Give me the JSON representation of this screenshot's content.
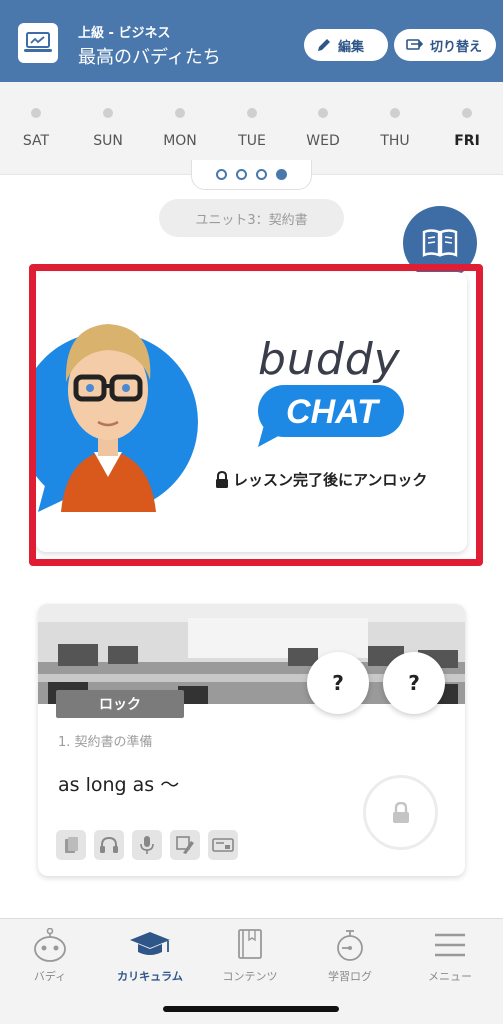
{
  "header": {
    "course_level": "上級 - ビジネス",
    "course_name": "最高のバディたち",
    "edit_label": "編集",
    "switch_label": "切り替え",
    "bg_color": "#4a78ad"
  },
  "week": {
    "days": [
      "SAT",
      "SUN",
      "MON",
      "TUE",
      "WED",
      "THU",
      "FRI"
    ],
    "active_day": "FRI",
    "pages": 4,
    "active_page": 4
  },
  "unit": {
    "label": "ユニット3：契約書"
  },
  "buddy_chat": {
    "word_buddy": "buddy",
    "word_chat": "CHAT",
    "unlock_text": "レッスン完了後にアンロック",
    "accent": "#1e88e5"
  },
  "lesson": {
    "status": "ロック",
    "number_title": "1. 契約書の準備",
    "phrase": "as long as 〜",
    "skills": [
      "card-icon",
      "headphones-icon",
      "microphone-icon",
      "pronunciation-icon",
      "flashcard-icon"
    ],
    "quiz_buttons": [
      "?",
      "?"
    ]
  },
  "nav": {
    "items": [
      {
        "label": "バディ",
        "icon": "robot-icon"
      },
      {
        "label": "カリキュラム",
        "icon": "graduation-cap-icon"
      },
      {
        "label": "コンテンツ",
        "icon": "book-icon"
      },
      {
        "label": "学習ログ",
        "icon": "stopwatch-icon"
      },
      {
        "label": "メニュー",
        "icon": "menu-icon"
      }
    ],
    "active": "カリキュラム"
  }
}
